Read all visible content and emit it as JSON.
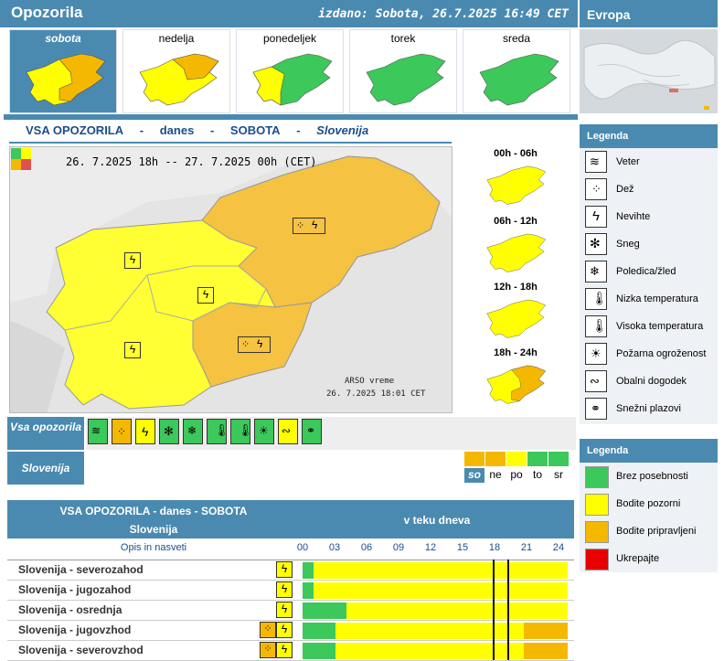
{
  "header": {
    "title": "Opozorila",
    "issued": "izdano: Sobota, 26.7.2025 16:49 CET"
  },
  "days": [
    {
      "label": "sobota",
      "selected": true,
      "level": "mixed"
    },
    {
      "label": "nedelja",
      "selected": false,
      "level": "mixed"
    },
    {
      "label": "ponedeljek",
      "selected": false,
      "level": "mixed"
    },
    {
      "label": "torek",
      "selected": false,
      "level": "green"
    },
    {
      "label": "sreda",
      "selected": false,
      "level": "green"
    }
  ],
  "europe": {
    "label": "Evropa"
  },
  "title": {
    "p1": "VSA OPOZORILA",
    "sep": "-",
    "p2": "danes",
    "p3": "SOBOTA",
    "p4": "Slovenija"
  },
  "map": {
    "period": "26. 7.2025 18h  --  27. 7.2025 00h     (CET)",
    "credit1": "ARSO vreme",
    "credit2": "26. 7.2025  18:01 CET"
  },
  "slots": [
    {
      "label": "00h - 06h"
    },
    {
      "label": "06h - 12h"
    },
    {
      "label": "12h - 18h"
    },
    {
      "label": "18h - 24h"
    }
  ],
  "vsa": {
    "label": "Vsa opozorila"
  },
  "slovenija_row": {
    "label": "Slovenija",
    "days": [
      "so",
      "ne",
      "po",
      "to",
      "sr"
    ],
    "colors": [
      "#f5b800",
      "#f5b800",
      "#ffff00",
      "#3cc85a",
      "#3cc85a"
    ]
  },
  "table": {
    "title": "VSA OPOZORILA - danes - SOBOTA",
    "subtitle": "Slovenija",
    "right": "v teku dneva",
    "opis": "Opis in nasveti",
    "hours": [
      "00",
      "03",
      "06",
      "09",
      "12",
      "15",
      "18",
      "21",
      "24"
    ],
    "rows": [
      {
        "name": "Slovenija - severozahod",
        "segs": [
          [
            "#3cc85a",
            1
          ],
          [
            "#ffff00",
            23
          ]
        ]
      },
      {
        "name": "Slovenija - jugozahod",
        "segs": [
          [
            "#3cc85a",
            1
          ],
          [
            "#ffff00",
            23
          ]
        ]
      },
      {
        "name": "Slovenija - osrednja",
        "segs": [
          [
            "#3cc85a",
            4
          ],
          [
            "#ffff00",
            20
          ]
        ]
      },
      {
        "name": "Slovenija - jugovzhod",
        "segs": [
          [
            "#3cc85a",
            3
          ],
          [
            "#ffff00",
            17
          ],
          [
            "#f5b800",
            4
          ]
        ]
      },
      {
        "name": "Slovenija - severovzhod",
        "segs": [
          [
            "#3cc85a",
            3
          ],
          [
            "#ffff00",
            17
          ],
          [
            "#f5b800",
            4
          ]
        ]
      }
    ]
  },
  "legend1": {
    "title": "Legenda",
    "items": [
      {
        "label": "Veter",
        "icon": "wind-icon"
      },
      {
        "label": "Dež",
        "icon": "rain-icon"
      },
      {
        "label": "Nevihte",
        "icon": "thunderstorm-icon"
      },
      {
        "label": "Sneg",
        "icon": "snow-icon"
      },
      {
        "label": "Poledica/žled",
        "icon": "ice-icon"
      },
      {
        "label": "Nizka temperatura",
        "icon": "low-temp-icon"
      },
      {
        "label": "Visoka temperatura",
        "icon": "high-temp-icon"
      },
      {
        "label": "Požarna ogroženost",
        "icon": "fire-icon"
      },
      {
        "label": "Obalni dogodek",
        "icon": "coastal-icon"
      },
      {
        "label": "Snežni plazovi",
        "icon": "avalanche-icon"
      }
    ]
  },
  "legend2": {
    "title": "Legenda",
    "items": [
      {
        "label": "Brez posebnosti",
        "color": "#3cc85a"
      },
      {
        "label": "Bodite pozorni",
        "color": "#ffff00"
      },
      {
        "label": "Bodite pripravljeni",
        "color": "#f5b800"
      },
      {
        "label": "Ukrepajte",
        "color": "#e60000"
      }
    ]
  },
  "colors": {
    "green": "#3cc85a",
    "yellow": "#ffff00",
    "orange": "#f5b800",
    "red": "#e60000",
    "accent": "#4a8ab0"
  }
}
